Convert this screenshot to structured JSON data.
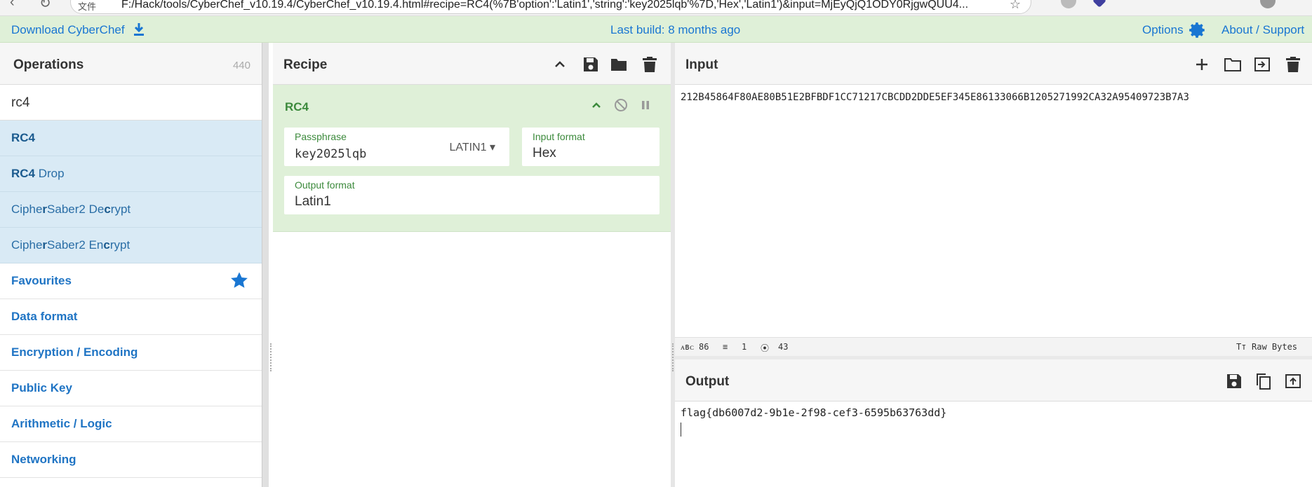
{
  "browser": {
    "url": "F:/Hack/tools/CyberChef_v10.19.4/CyberChef_v10.19.4.html#recipe=RC4(%7B'option':'Latin1','string':'key2025lqb'%7D,'Hex','Latin1')&input=MjEyQjQ1ODY0RjgwQUU4...",
    "security_label": "文件"
  },
  "banner": {
    "download_label": "Download CyberChef",
    "last_build": "Last build: 8 months ago",
    "options_label": "Options",
    "about_label": "About / Support"
  },
  "operations": {
    "title": "Operations",
    "count": "440",
    "search_value": "rc4",
    "results": [
      {
        "bold": "RC4",
        "rest": ""
      },
      {
        "bold": "RC4",
        "rest": " Drop"
      },
      {
        "pre": "Ciphe",
        "bold": "r",
        "mid": "Saber2 De",
        "bold2": "c",
        "rest": "rypt"
      },
      {
        "pre": "Ciphe",
        "bold": "r",
        "mid": "Saber2 En",
        "bold2": "c",
        "rest": "rypt"
      }
    ],
    "categories": [
      "Favourites",
      "Data format",
      "Encryption / Encoding",
      "Public Key",
      "Arithmetic / Logic",
      "Networking"
    ]
  },
  "recipe": {
    "title": "Recipe",
    "operation_name": "RC4",
    "passphrase_label": "Passphrase",
    "passphrase_value": "key2025lqb",
    "passphrase_encoding": "LATIN1",
    "input_format_label": "Input format",
    "input_format_value": "Hex",
    "output_format_label": "Output format",
    "output_format_value": "Latin1"
  },
  "input": {
    "title": "Input",
    "text": "212B45864F80AE80B51E2BFBDF1CC71217CBCDD2DDE5EF345E86133066B1205271992CA32A95409723B7A3",
    "stats": {
      "chars": "86",
      "lines": "1",
      "position": "43",
      "format": "Raw Bytes"
    }
  },
  "output": {
    "title": "Output",
    "text": "flag{db6007d2-9b1e-2f98-cef3-6595b63763dd}"
  },
  "colors": {
    "accent": "#1976d2",
    "banner_bg": "#dff0d8",
    "op_card_bg": "#dff0d8",
    "search_result_bg": "#d9eaf5"
  }
}
